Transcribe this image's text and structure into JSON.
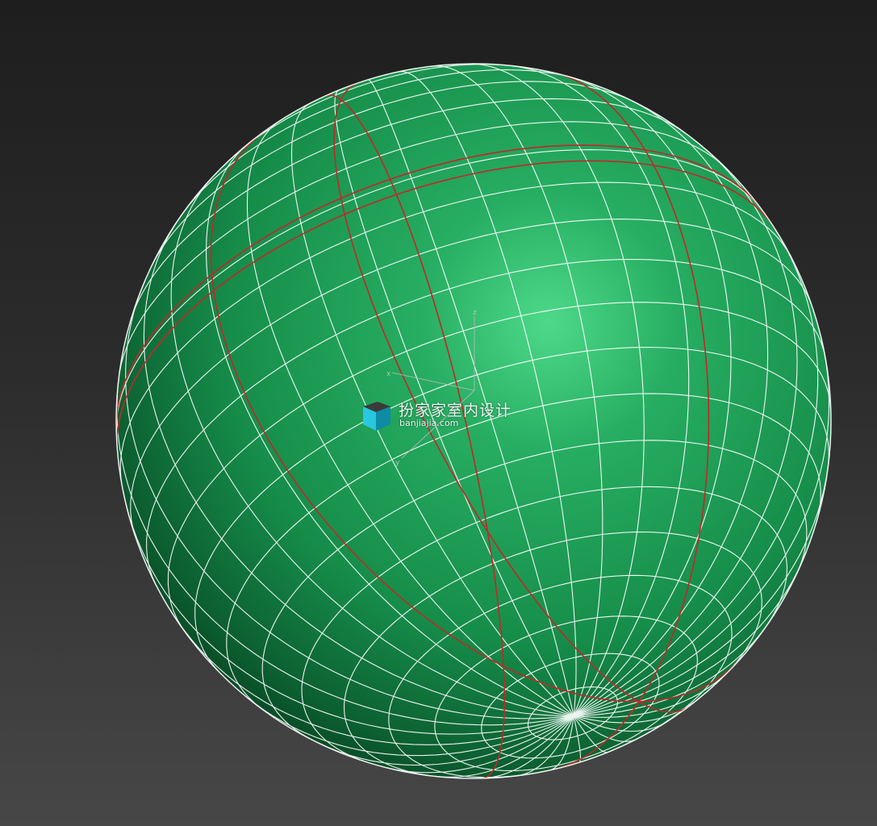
{
  "viewport": {
    "background_top": "#1e1e1e",
    "background_bottom": "#474747"
  },
  "model": {
    "object": "sphere",
    "surface_color": "#1f9a52",
    "highlight_color": "#4ed98a",
    "wire_color": "#ffffff",
    "seam_color": "#c0282a"
  },
  "gizmo": {
    "icon": "transform-gizmo-icon"
  },
  "watermark": {
    "logo_icon": "cube-logo-icon",
    "text_cn": "扮家家室内设计",
    "text_en": "banjiajia.com"
  }
}
